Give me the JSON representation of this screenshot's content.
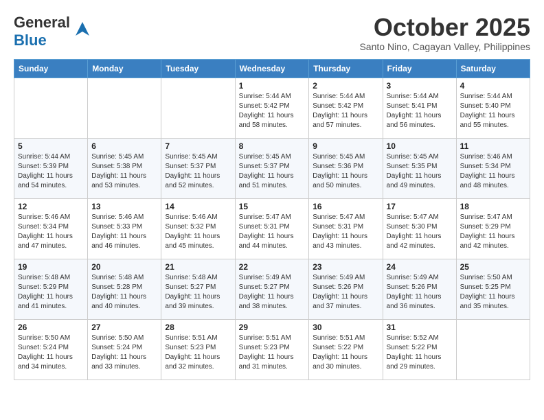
{
  "header": {
    "logo_general": "General",
    "logo_blue": "Blue",
    "month": "October 2025",
    "location": "Santo Nino, Cagayan Valley, Philippines"
  },
  "days_of_week": [
    "Sunday",
    "Monday",
    "Tuesday",
    "Wednesday",
    "Thursday",
    "Friday",
    "Saturday"
  ],
  "weeks": [
    [
      {
        "day": "",
        "sunrise": "",
        "sunset": "",
        "daylight": ""
      },
      {
        "day": "",
        "sunrise": "",
        "sunset": "",
        "daylight": ""
      },
      {
        "day": "",
        "sunrise": "",
        "sunset": "",
        "daylight": ""
      },
      {
        "day": "1",
        "sunrise": "Sunrise: 5:44 AM",
        "sunset": "Sunset: 5:42 PM",
        "daylight": "Daylight: 11 hours and 58 minutes."
      },
      {
        "day": "2",
        "sunrise": "Sunrise: 5:44 AM",
        "sunset": "Sunset: 5:42 PM",
        "daylight": "Daylight: 11 hours and 57 minutes."
      },
      {
        "day": "3",
        "sunrise": "Sunrise: 5:44 AM",
        "sunset": "Sunset: 5:41 PM",
        "daylight": "Daylight: 11 hours and 56 minutes."
      },
      {
        "day": "4",
        "sunrise": "Sunrise: 5:44 AM",
        "sunset": "Sunset: 5:40 PM",
        "daylight": "Daylight: 11 hours and 55 minutes."
      }
    ],
    [
      {
        "day": "5",
        "sunrise": "Sunrise: 5:44 AM",
        "sunset": "Sunset: 5:39 PM",
        "daylight": "Daylight: 11 hours and 54 minutes."
      },
      {
        "day": "6",
        "sunrise": "Sunrise: 5:45 AM",
        "sunset": "Sunset: 5:38 PM",
        "daylight": "Daylight: 11 hours and 53 minutes."
      },
      {
        "day": "7",
        "sunrise": "Sunrise: 5:45 AM",
        "sunset": "Sunset: 5:37 PM",
        "daylight": "Daylight: 11 hours and 52 minutes."
      },
      {
        "day": "8",
        "sunrise": "Sunrise: 5:45 AM",
        "sunset": "Sunset: 5:37 PM",
        "daylight": "Daylight: 11 hours and 51 minutes."
      },
      {
        "day": "9",
        "sunrise": "Sunrise: 5:45 AM",
        "sunset": "Sunset: 5:36 PM",
        "daylight": "Daylight: 11 hours and 50 minutes."
      },
      {
        "day": "10",
        "sunrise": "Sunrise: 5:45 AM",
        "sunset": "Sunset: 5:35 PM",
        "daylight": "Daylight: 11 hours and 49 minutes."
      },
      {
        "day": "11",
        "sunrise": "Sunrise: 5:46 AM",
        "sunset": "Sunset: 5:34 PM",
        "daylight": "Daylight: 11 hours and 48 minutes."
      }
    ],
    [
      {
        "day": "12",
        "sunrise": "Sunrise: 5:46 AM",
        "sunset": "Sunset: 5:34 PM",
        "daylight": "Daylight: 11 hours and 47 minutes."
      },
      {
        "day": "13",
        "sunrise": "Sunrise: 5:46 AM",
        "sunset": "Sunset: 5:33 PM",
        "daylight": "Daylight: 11 hours and 46 minutes."
      },
      {
        "day": "14",
        "sunrise": "Sunrise: 5:46 AM",
        "sunset": "Sunset: 5:32 PM",
        "daylight": "Daylight: 11 hours and 45 minutes."
      },
      {
        "day": "15",
        "sunrise": "Sunrise: 5:47 AM",
        "sunset": "Sunset: 5:31 PM",
        "daylight": "Daylight: 11 hours and 44 minutes."
      },
      {
        "day": "16",
        "sunrise": "Sunrise: 5:47 AM",
        "sunset": "Sunset: 5:31 PM",
        "daylight": "Daylight: 11 hours and 43 minutes."
      },
      {
        "day": "17",
        "sunrise": "Sunrise: 5:47 AM",
        "sunset": "Sunset: 5:30 PM",
        "daylight": "Daylight: 11 hours and 42 minutes."
      },
      {
        "day": "18",
        "sunrise": "Sunrise: 5:47 AM",
        "sunset": "Sunset: 5:29 PM",
        "daylight": "Daylight: 11 hours and 42 minutes."
      }
    ],
    [
      {
        "day": "19",
        "sunrise": "Sunrise: 5:48 AM",
        "sunset": "Sunset: 5:29 PM",
        "daylight": "Daylight: 11 hours and 41 minutes."
      },
      {
        "day": "20",
        "sunrise": "Sunrise: 5:48 AM",
        "sunset": "Sunset: 5:28 PM",
        "daylight": "Daylight: 11 hours and 40 minutes."
      },
      {
        "day": "21",
        "sunrise": "Sunrise: 5:48 AM",
        "sunset": "Sunset: 5:27 PM",
        "daylight": "Daylight: 11 hours and 39 minutes."
      },
      {
        "day": "22",
        "sunrise": "Sunrise: 5:49 AM",
        "sunset": "Sunset: 5:27 PM",
        "daylight": "Daylight: 11 hours and 38 minutes."
      },
      {
        "day": "23",
        "sunrise": "Sunrise: 5:49 AM",
        "sunset": "Sunset: 5:26 PM",
        "daylight": "Daylight: 11 hours and 37 minutes."
      },
      {
        "day": "24",
        "sunrise": "Sunrise: 5:49 AM",
        "sunset": "Sunset: 5:26 PM",
        "daylight": "Daylight: 11 hours and 36 minutes."
      },
      {
        "day": "25",
        "sunrise": "Sunrise: 5:50 AM",
        "sunset": "Sunset: 5:25 PM",
        "daylight": "Daylight: 11 hours and 35 minutes."
      }
    ],
    [
      {
        "day": "26",
        "sunrise": "Sunrise: 5:50 AM",
        "sunset": "Sunset: 5:24 PM",
        "daylight": "Daylight: 11 hours and 34 minutes."
      },
      {
        "day": "27",
        "sunrise": "Sunrise: 5:50 AM",
        "sunset": "Sunset: 5:24 PM",
        "daylight": "Daylight: 11 hours and 33 minutes."
      },
      {
        "day": "28",
        "sunrise": "Sunrise: 5:51 AM",
        "sunset": "Sunset: 5:23 PM",
        "daylight": "Daylight: 11 hours and 32 minutes."
      },
      {
        "day": "29",
        "sunrise": "Sunrise: 5:51 AM",
        "sunset": "Sunset: 5:23 PM",
        "daylight": "Daylight: 11 hours and 31 minutes."
      },
      {
        "day": "30",
        "sunrise": "Sunrise: 5:51 AM",
        "sunset": "Sunset: 5:22 PM",
        "daylight": "Daylight: 11 hours and 30 minutes."
      },
      {
        "day": "31",
        "sunrise": "Sunrise: 5:52 AM",
        "sunset": "Sunset: 5:22 PM",
        "daylight": "Daylight: 11 hours and 29 minutes."
      },
      {
        "day": "",
        "sunrise": "",
        "sunset": "",
        "daylight": ""
      }
    ]
  ]
}
